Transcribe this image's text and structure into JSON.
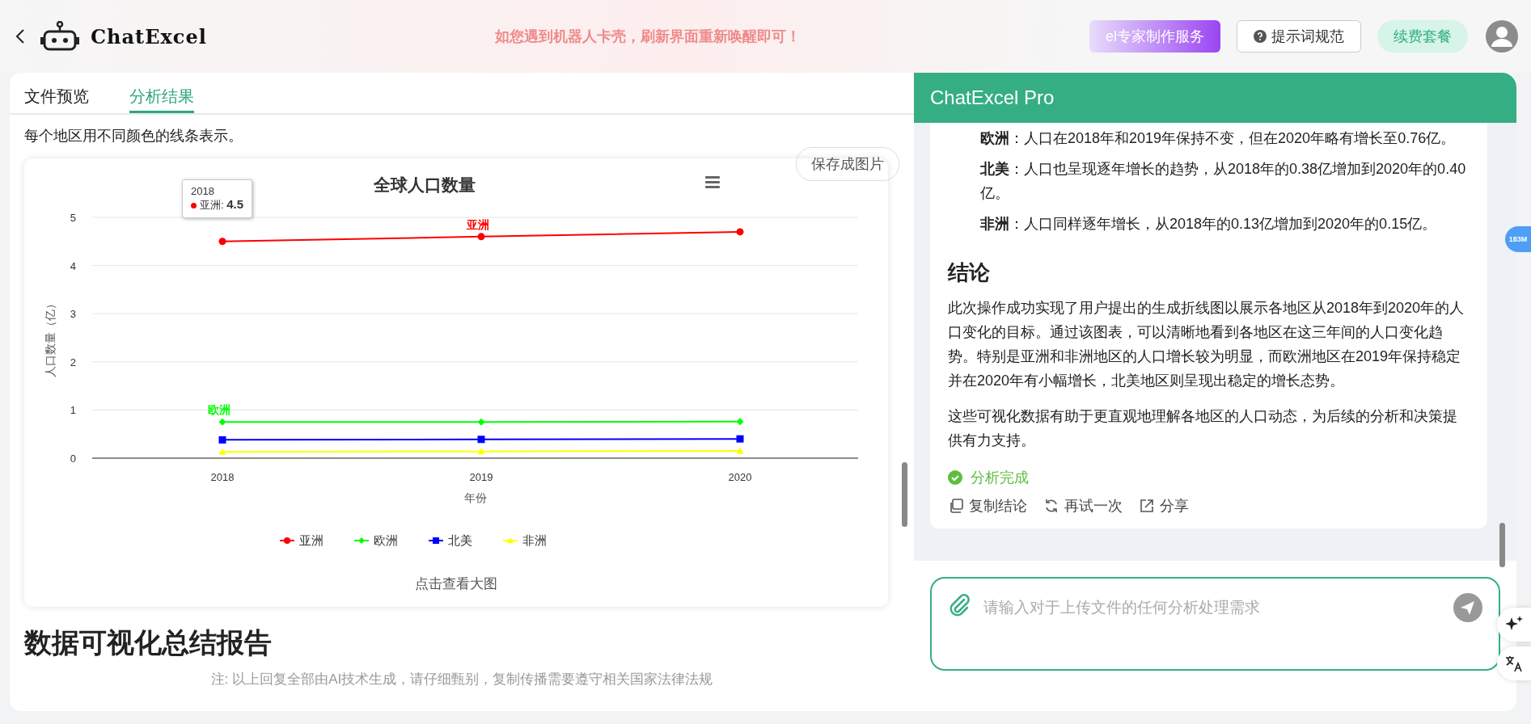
{
  "header": {
    "brand": "ChatExcel",
    "notice": "如您遇到机器人卡壳，刷新界面重新唤醒即可！",
    "buttons": [
      {
        "label": "el专家制作服务",
        "kind": "promo"
      },
      {
        "label": "提示词规范",
        "kind": "help"
      },
      {
        "label": "续费套餐",
        "kind": "renew"
      }
    ]
  },
  "left": {
    "tabs": [
      {
        "label": "文件预览",
        "selected": false
      },
      {
        "label": "分析结果",
        "selected": true
      }
    ],
    "intro": "每个地区用不同颜色的线条表示。",
    "save_button": "保存成图片",
    "chart": {
      "chart_data": {
        "type": "line",
        "title": "全球人口数量",
        "xlabel": "年份",
        "ylabel": "人口数量（亿）",
        "categories": [
          "2018",
          "2019",
          "2020"
        ],
        "yticks": [
          0,
          1,
          2,
          3,
          4,
          5
        ],
        "ylim": [
          0,
          5
        ],
        "series": [
          {
            "name": "亚洲",
            "color": "#ff0000",
            "marker": "circle",
            "values": [
              4.5,
              4.6,
              4.7
            ]
          },
          {
            "name": "欧洲",
            "color": "#00ff00",
            "marker": "diamond",
            "values": [
              0.75,
              0.75,
              0.76
            ]
          },
          {
            "name": "北美",
            "color": "#0000ff",
            "marker": "square",
            "values": [
              0.38,
              0.39,
              0.4
            ]
          },
          {
            "name": "非洲",
            "color": "#ffff00",
            "marker": "triangle",
            "values": [
              0.13,
              0.14,
              0.15
            ]
          }
        ],
        "grid": true,
        "legend": "bottom",
        "annotations": [
          {
            "text": "亚洲",
            "x": "2019",
            "y": 4.6
          },
          {
            "text": "欧洲",
            "x": "2018",
            "y": 0.75
          }
        ]
      },
      "tooltip": {
        "title": "2018",
        "name": "亚洲:",
        "value": "4.5",
        "color": "#ff0000"
      },
      "enlarge_link": "点击查看大图"
    },
    "next_heading": "数据可视化总结报告",
    "footnote": "注: 以上回复全部由AI技术生成，请仔细甄别，复制传播需要遵守相关国家法律法规"
  },
  "right": {
    "title": "ChatExcel Pro",
    "list": [
      "**欧洲**：人口在2018年和2019年保持不变，但在2020年略有增长至0.76亿。",
      "**北美**：人口也呈现逐年增长的趋势，从2018年的0.38亿增加到2020年的0.40亿。",
      "**非洲**：人口同样逐年增长，从2018年的0.13亿增加到2020年的0.15亿。"
    ],
    "heading": "结论",
    "paragraphs": [
      "此次操作成功实现了用户提出的生成折线图以展示各地区从2018年到2020年的人口变化的目标。通过该图表，可以清晰地看到各地区在这三年间的人口变化趋势。特别是亚洲和非洲地区的人口增长较为明显，而欧洲地区在2019年保持稳定并在2020年有小幅增长，北美地区则呈现出稳定的增长态势。",
      "这些可视化数据有助于更直观地理解各地区的人口动态，为后续的分析和决策提供有力支持。"
    ],
    "status": "分析完成",
    "actions": [
      {
        "label": "复制结论",
        "kind": "copy"
      },
      {
        "label": "再试一次",
        "kind": "retry"
      },
      {
        "label": "分享",
        "kind": "share"
      }
    ],
    "input": {
      "placeholder": "请输入对于上传文件的任何分析处理需求"
    },
    "badge": "183M"
  }
}
